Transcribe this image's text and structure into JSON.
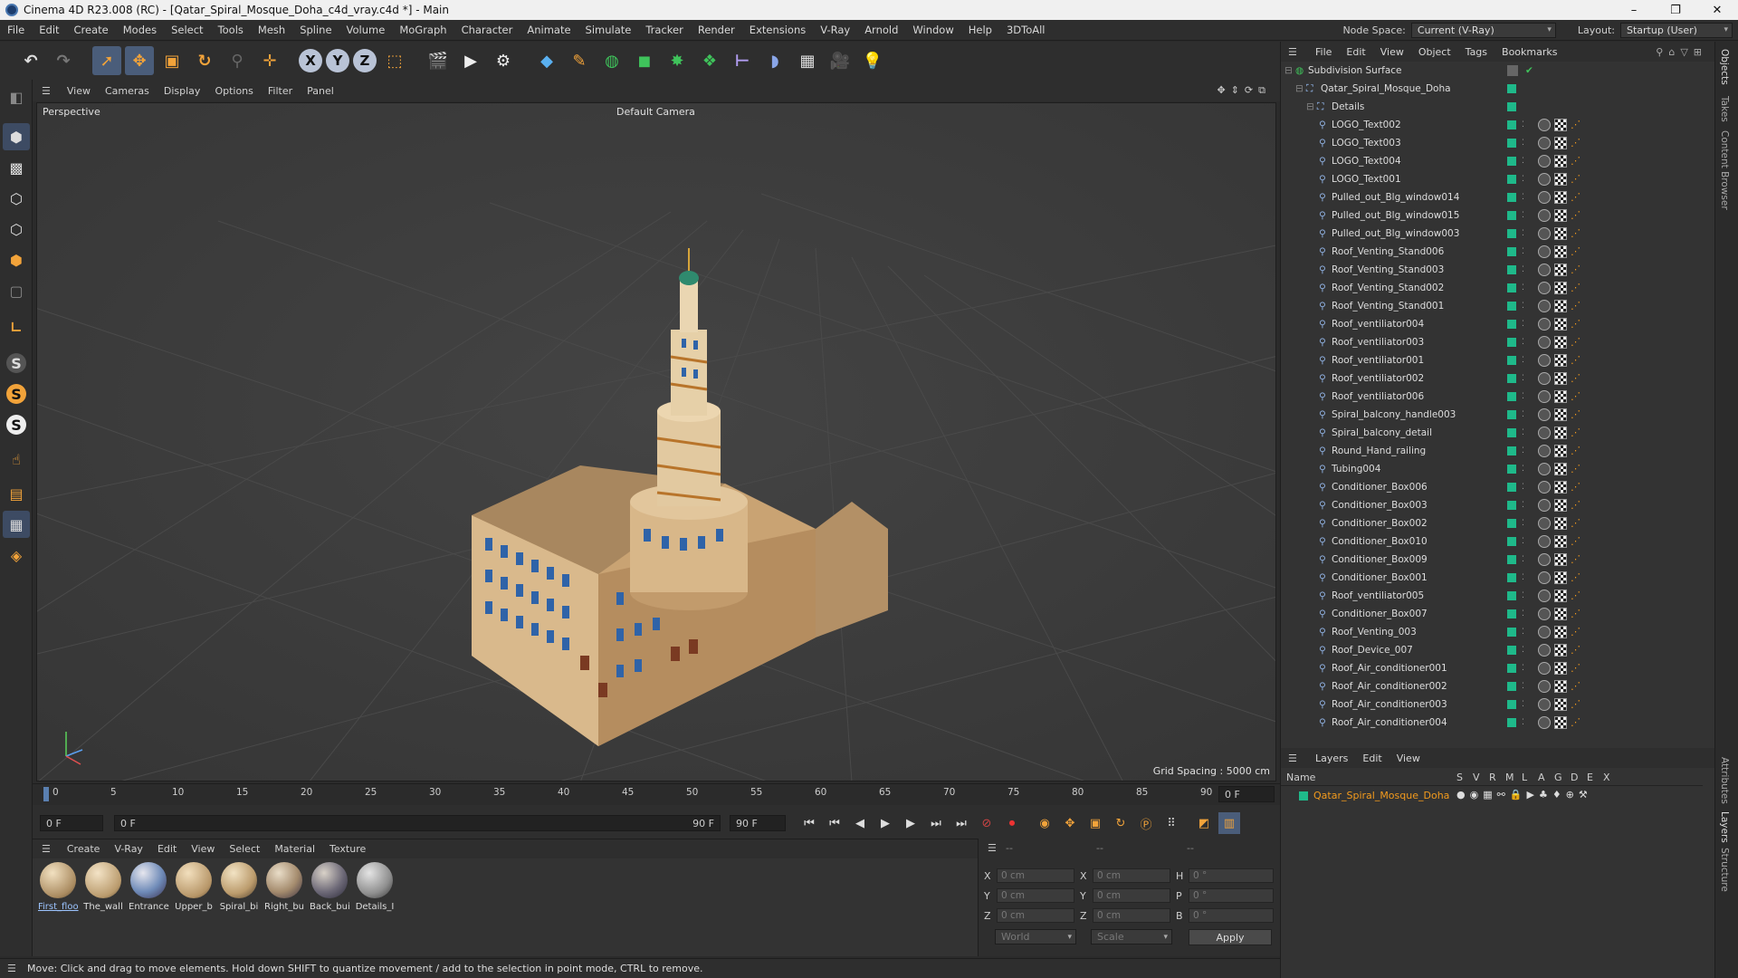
{
  "window": {
    "title": "Cinema 4D R23.008 (RC) - [Qatar_Spiral_Mosque_Doha_c4d_vray.c4d *] - Main",
    "controls": [
      "–",
      "❐",
      "✕"
    ]
  },
  "menu": {
    "items": [
      "File",
      "Edit",
      "Create",
      "Modes",
      "Select",
      "Tools",
      "Mesh",
      "Spline",
      "Volume",
      "MoGraph",
      "Character",
      "Animate",
      "Simulate",
      "Tracker",
      "Render",
      "Extensions",
      "V-Ray",
      "Arnold",
      "Window",
      "Help",
      "3DToAll"
    ],
    "node_space_label": "Node Space:",
    "node_space_value": "Current (V-Ray)",
    "layout_label": "Layout:",
    "layout_value": "Startup (User)"
  },
  "viewport": {
    "menu": [
      "View",
      "Cameras",
      "Display",
      "Options",
      "Filter",
      "Panel"
    ],
    "name": "Perspective",
    "camera": "Default Camera",
    "grid_spacing": "Grid Spacing : 5000 cm"
  },
  "timeline": {
    "ticks": [
      "0",
      "5",
      "10",
      "15",
      "20",
      "25",
      "30",
      "35",
      "40",
      "45",
      "50",
      "55",
      "60",
      "65",
      "70",
      "75",
      "80",
      "85",
      "90"
    ],
    "end_field": "0 F",
    "start_frame": "0 F",
    "range_start": "0 F",
    "range_end": "90 F",
    "end_frame": "90 F"
  },
  "materials": {
    "menu": [
      "Create",
      "V-Ray",
      "Edit",
      "View",
      "Select",
      "Material",
      "Texture"
    ],
    "items": [
      "First_floo",
      "The_wall",
      "Entrance",
      "Upper_b",
      "Spiral_bi",
      "Right_bu",
      "Back_bui",
      "Details_I"
    ]
  },
  "coords": {
    "headers": [
      "--",
      "--",
      "--"
    ],
    "rows": [
      {
        "a": "X",
        "av": "0 cm",
        "b": "X",
        "bv": "0 cm",
        "c": "H",
        "cv": "0 °"
      },
      {
        "a": "Y",
        "av": "0 cm",
        "b": "Y",
        "bv": "0 cm",
        "c": "P",
        "cv": "0 °"
      },
      {
        "a": "Z",
        "av": "0 cm",
        "b": "Z",
        "bv": "0 cm",
        "c": "B",
        "cv": "0 °"
      }
    ],
    "space": "World",
    "mode": "Scale",
    "apply": "Apply"
  },
  "status": "Move: Click and drag to move elements. Hold down SHIFT to quantize movement / add to the selection in point mode, CTRL to remove.",
  "objects": {
    "menu": [
      "File",
      "Edit",
      "View",
      "Object",
      "Tags",
      "Bookmarks"
    ],
    "root": "Subdivision Surface",
    "model": "Qatar_Spiral_Mosque_Doha",
    "group": "Details",
    "items": [
      "LOGO_Text002",
      "LOGO_Text003",
      "LOGO_Text004",
      "LOGO_Text001",
      "Pulled_out_Blg_window014",
      "Pulled_out_Blg_window015",
      "Pulled_out_Blg_window003",
      "Roof_Venting_Stand006",
      "Roof_Venting_Stand003",
      "Roof_Venting_Stand002",
      "Roof_Venting_Stand001",
      "Roof_ventiliator004",
      "Roof_ventiliator003",
      "Roof_ventiliator001",
      "Roof_ventiliator002",
      "Roof_ventiliator006",
      "Spiral_balcony_handle003",
      "Spiral_balcony_detail",
      "Round_Hand_railing",
      "Tubing004",
      "Conditioner_Box006",
      "Conditioner_Box003",
      "Conditioner_Box002",
      "Conditioner_Box010",
      "Conditioner_Box009",
      "Conditioner_Box001",
      "Roof_ventiliator005",
      "Conditioner_Box007",
      "Roof_Venting_003",
      "Roof_Device_007",
      "Roof_Air_conditioner001",
      "Roof_Air_conditioner002",
      "Roof_Air_conditioner003",
      "Roof_Air_conditioner004"
    ]
  },
  "layers": {
    "menu": [
      "Layers",
      "Edit",
      "View"
    ],
    "col_name": "Name",
    "cols": [
      "S",
      "V",
      "R",
      "M",
      "L",
      "A",
      "G",
      "D",
      "E",
      "X"
    ],
    "item": "Qatar_Spiral_Mosque_Doha"
  },
  "side_tabs": [
    "Objects",
    "Takes",
    "Content Browser",
    "Attributes",
    "Layers",
    "Structure"
  ],
  "colors": {
    "accent": "#4a5d7a",
    "tag_green": "#1fb98a",
    "layer_orange": "#f29a1d"
  }
}
